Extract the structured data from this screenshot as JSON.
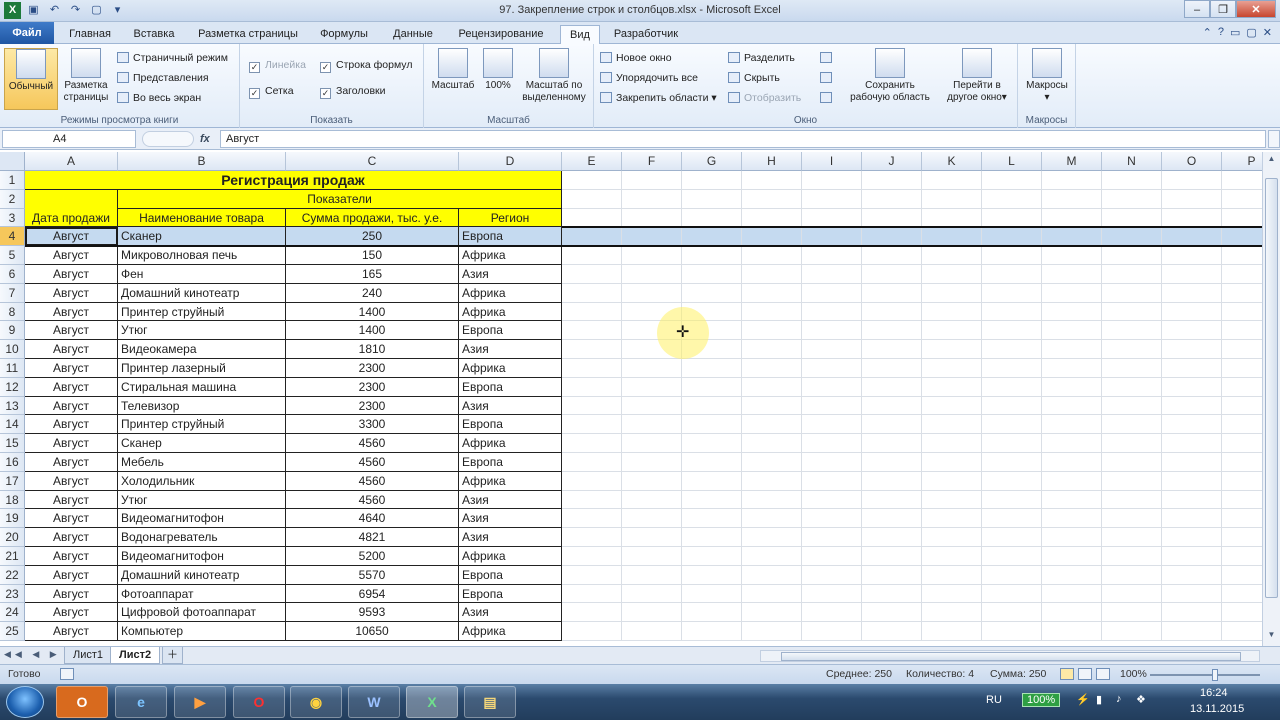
{
  "window": {
    "title": "97. Закрепление строк и столбцов.xlsx - Microsoft Excel"
  },
  "tabs": [
    "Файл",
    "Главная",
    "Вставка",
    "Разметка страницы",
    "Формулы",
    "Данные",
    "Рецензирование",
    "Вид",
    "Разработчик"
  ],
  "active_tab": "Вид",
  "ribbon": {
    "views": {
      "normal": "Обычный",
      "layout_line1": "Разметка",
      "layout_line2": "страницы",
      "page_mode": "Страничный режим",
      "custom_views": "Представления",
      "full_screen": "Во весь экран",
      "label": "Режимы просмотра книги"
    },
    "show": {
      "ruler": "Линейка",
      "formula_bar": "Строка формул",
      "gridlines": "Сетка",
      "headings": "Заголовки",
      "label": "Показать"
    },
    "zoom": {
      "zoom": "Масштаб",
      "zoom100": "100%",
      "zoom_sel_line1": "Масштаб по",
      "zoom_sel_line2": "выделенному",
      "label": "Масштаб"
    },
    "window": {
      "new_window": "Новое окно",
      "arrange_all": "Упорядочить все",
      "freeze_panes": "Закрепить области",
      "split": "Разделить",
      "hide": "Скрыть",
      "unhide": "Отобразить",
      "save_ws_line1": "Сохранить",
      "save_ws_line2": "рабочую область",
      "switch_line1": "Перейти в",
      "switch_line2": "другое окно",
      "label": "Окно"
    },
    "macros": {
      "macros": "Макросы",
      "label": "Макросы"
    }
  },
  "formula_bar": {
    "name_box": "A4",
    "fx": "fx",
    "value": "Август"
  },
  "columns": [
    "A",
    "B",
    "C",
    "D",
    "E",
    "F",
    "G",
    "H",
    "I",
    "J",
    "K",
    "L",
    "M",
    "N",
    "O",
    "P"
  ],
  "table": {
    "title": "Регистрация продаж",
    "group_header": "Показатели",
    "headers": [
      "Дата продажи",
      "Наименование товара",
      "Сумма продажи, тыс. у.е.",
      "Регион"
    ],
    "rows": [
      [
        "Август",
        "Сканер",
        "250",
        "Европа"
      ],
      [
        "Август",
        "Микроволновая печь",
        "150",
        "Африка"
      ],
      [
        "Август",
        "Фен",
        "165",
        "Азия"
      ],
      [
        "Август",
        "Домашний кинотеатр",
        "240",
        "Африка"
      ],
      [
        "Август",
        "Принтер струйный",
        "1400",
        "Африка"
      ],
      [
        "Август",
        "Утюг",
        "1400",
        "Европа"
      ],
      [
        "Август",
        "Видеокамера",
        "1810",
        "Азия"
      ],
      [
        "Август",
        "Принтер лазерный",
        "2300",
        "Африка"
      ],
      [
        "Август",
        "Стиральная машина",
        "2300",
        "Европа"
      ],
      [
        "Август",
        "Телевизор",
        "2300",
        "Азия"
      ],
      [
        "Август",
        "Принтер струйный",
        "3300",
        "Европа"
      ],
      [
        "Август",
        "Сканер",
        "4560",
        "Африка"
      ],
      [
        "Август",
        "Мебель",
        "4560",
        "Европа"
      ],
      [
        "Август",
        "Холодильник",
        "4560",
        "Африка"
      ],
      [
        "Август",
        "Утюг",
        "4560",
        "Азия"
      ],
      [
        "Август",
        "Видеомагнитофон",
        "4640",
        "Азия"
      ],
      [
        "Август",
        "Водонагреватель",
        "4821",
        "Азия"
      ],
      [
        "Август",
        "Видеомагнитофон",
        "5200",
        "Африка"
      ],
      [
        "Август",
        "Домашний кинотеатр",
        "5570",
        "Европа"
      ],
      [
        "Август",
        "Фотоаппарат",
        "6954",
        "Европа"
      ],
      [
        "Август",
        "Цифровой фотоаппарат",
        "9593",
        "Азия"
      ],
      [
        "Август",
        "Компьютер",
        "10650",
        "Африка"
      ]
    ]
  },
  "sheets": [
    "Лист1",
    "Лист2"
  ],
  "active_sheet": "Лист2",
  "status": {
    "ready": "Готово",
    "average": "Среднее: 250",
    "count": "Количество: 4",
    "sum": "Сумма: 250",
    "zoom": "100%"
  },
  "taskbar": {
    "apps": [
      "O",
      "e",
      "▶",
      "O",
      "◉",
      "W",
      "X",
      "▤"
    ],
    "lang": "RU",
    "battery": "100%",
    "time": "16:24",
    "date": "13.11.2015"
  },
  "colors": {
    "header_fill": "#ffff00",
    "selection_row": "#c5daf0",
    "file_tab": "#1f56a3"
  }
}
